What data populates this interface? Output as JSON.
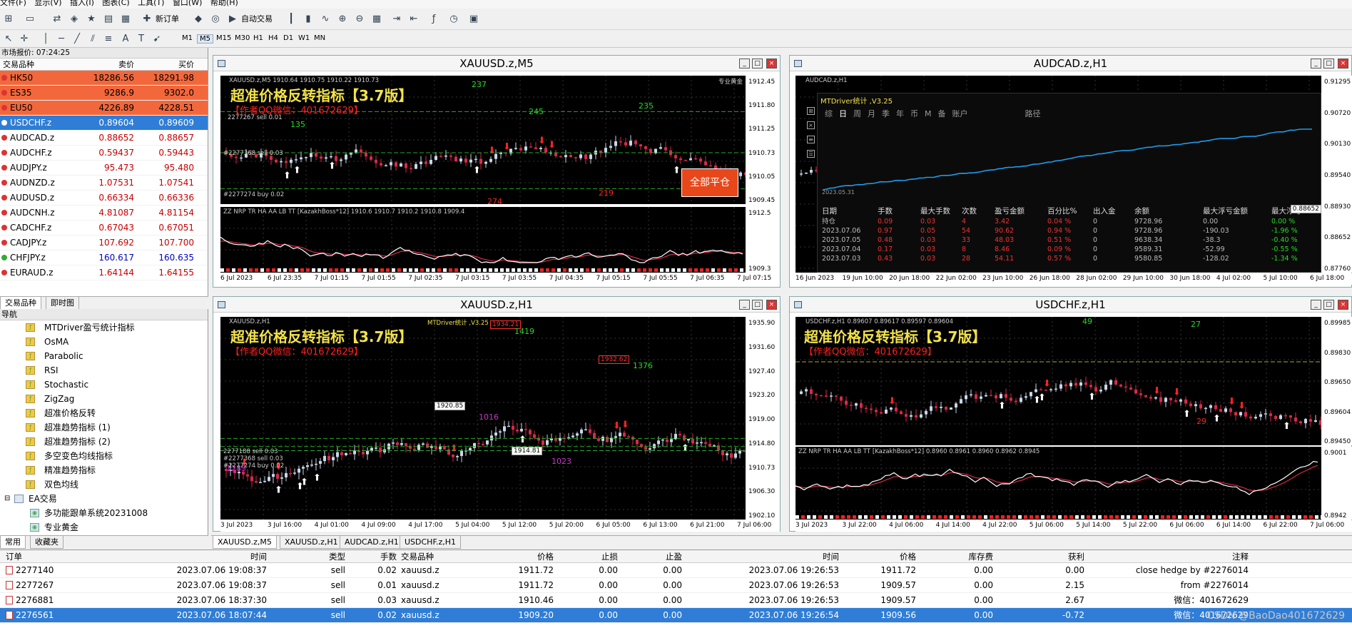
{
  "menubar": [
    "文件(F)",
    "显示(V)",
    "插入(I)",
    "图表(C)",
    "工具(T)",
    "窗口(W)",
    "帮助(H)"
  ],
  "toolbar": {
    "new_order": "新订单",
    "autotrade": "自动交易"
  },
  "timeframes": [
    "M1",
    "M5",
    "M15",
    "M30",
    "H1",
    "H4",
    "D1",
    "W1",
    "MN"
  ],
  "market_watch": {
    "title": "市场报价: 07:24:25",
    "headers": [
      "交易品种",
      "卖价",
      "买价"
    ],
    "rows": [
      {
        "symbol": "HK50",
        "bid": "18286.56",
        "ask": "18291.98",
        "style": "red"
      },
      {
        "symbol": "ES35",
        "bid": "9286.9",
        "ask": "9302.0",
        "style": "red"
      },
      {
        "symbol": "EU50",
        "bid": "4226.89",
        "ask": "4228.51",
        "style": "red"
      },
      {
        "symbol": "USDCHF.z",
        "bid": "0.89604",
        "ask": "0.89609",
        "style": "sel"
      },
      {
        "symbol": "AUDCAD.z",
        "bid": "0.88652",
        "ask": "0.88657",
        "style": "dn"
      },
      {
        "symbol": "AUDCHF.z",
        "bid": "0.59437",
        "ask": "0.59443",
        "style": "dn"
      },
      {
        "symbol": "AUDJPY.z",
        "bid": "95.473",
        "ask": "95.480",
        "style": "dn"
      },
      {
        "symbol": "AUDNZD.z",
        "bid": "1.07531",
        "ask": "1.07541",
        "style": "dn"
      },
      {
        "symbol": "AUDUSD.z",
        "bid": "0.66334",
        "ask": "0.66336",
        "style": "dn"
      },
      {
        "symbol": "AUDCNH.z",
        "bid": "4.81087",
        "ask": "4.81154",
        "style": "dn"
      },
      {
        "symbol": "CADCHF.z",
        "bid": "0.67043",
        "ask": "0.67051",
        "style": "dn"
      },
      {
        "symbol": "CADJPY.z",
        "bid": "107.692",
        "ask": "107.700",
        "style": "dn"
      },
      {
        "symbol": "CHFJPY.z",
        "bid": "160.617",
        "ask": "160.635",
        "style": "up"
      },
      {
        "symbol": "EURAUD.z",
        "bid": "1.64144",
        "ask": "1.64155",
        "style": "dn"
      }
    ],
    "tabs": [
      "交易品种",
      "即时图"
    ]
  },
  "navigator": {
    "title": "导航",
    "items": [
      "MTDriver盈亏统计指标",
      "OsMA",
      "Parabolic",
      "RSI",
      "Stochastic",
      "ZigZag",
      "超准价格反转",
      "超准趋势指标 (1)",
      "超准趋势指标 (2)",
      "多空变色均线指标",
      "精准趋势指标",
      "双色均线"
    ],
    "folder": "EA交易",
    "ea_items": [
      "多功能跟单系统20231008",
      "专业黄金"
    ],
    "tabs": [
      "常用",
      "收藏夹"
    ]
  },
  "charts": {
    "c1": {
      "title": "XAUUSD.z,M5",
      "header": "XAUUSD.z,M5  1910.64 1910.75 1910.22 1910.73",
      "overlay_title": "超准价格反转指标【3.7版】",
      "overlay_author": "【作者QQ微信：401672629】",
      "corner_label": "专业黄金",
      "sub_header": "ZZ NRP TR HA AA LB TT [KazakhBoss*12]  1910.6 1910.7 1910.2 1910.8 1909.4",
      "close_all": "全部平仓",
      "labels": [
        "2277267 sell 0.01",
        "#2277368 sell 0.03",
        "#2277274 buy 0.02",
        "245",
        "235",
        "135",
        "219",
        "274",
        "237"
      ],
      "price_tag": "1910.73",
      "y_ticks": [
        "1912.45",
        "1911.80",
        "1911.25",
        "1910.73",
        "1910.05",
        "1909.45"
      ],
      "sub_y_ticks": [
        "1912.5",
        "1909.3"
      ],
      "x_ticks": [
        "6 Jul 2023",
        "6 Jul 23:35",
        "7 Jul 01:15",
        "7 Jul 01:55",
        "7 Jul 02:35",
        "7 Jul 03:15",
        "7 Jul 03:55",
        "7 Jul 04:35",
        "7 Jul 05:15",
        "7 Jul 05:55",
        "7 Jul 06:35",
        "7 Jul 07:15"
      ]
    },
    "c2": {
      "title": "AUDCAD.z,H1",
      "header": "AUDCAD.z,H1",
      "stats_title": "MTDriver统计 ,V3.25",
      "stats_tabs": [
        "综",
        "日",
        "周",
        "月",
        "季",
        "年",
        "币",
        "M",
        "备",
        "账户",
        "路径"
      ],
      "equity_date": "2023.05.31",
      "table_headers": [
        "日期",
        "手数",
        "最大手数",
        "次数",
        "盈亏金额",
        "百分比%",
        "出入金",
        "余额",
        "最大浮亏金额",
        "最大浮亏%"
      ],
      "table_rows": [
        [
          "持仓",
          "0.09",
          "0.03",
          "4",
          "3.42",
          "0.04 %",
          "0",
          "9728.96",
          "0.00",
          "0.00 %"
        ],
        [
          "2023.07.06",
          "0.97",
          "0.05",
          "54",
          "90.62",
          "0.94 %",
          "0",
          "9728.96",
          "-190.03",
          "-1.96 %"
        ],
        [
          "2023.07.05",
          "0.48",
          "0.03",
          "33",
          "48.03",
          "0.51 %",
          "0",
          "9638.34",
          "-38.3",
          "-0.40 %"
        ],
        [
          "2023.07.04",
          "0.17",
          "0.03",
          "8",
          "8.46",
          "0.09 %",
          "0",
          "9589.31",
          "-52.99",
          "-0.55 %"
        ],
        [
          "2023.07.03",
          "0.43",
          "0.03",
          "28",
          "54.11",
          "0.57 %",
          "0",
          "9580.85",
          "-128.02",
          "-1.34 %"
        ]
      ],
      "price_tag": "0.88652",
      "y_ticks": [
        "0.91295",
        "0.90720",
        "0.90130",
        "0.89540",
        "0.88930",
        "0.88652",
        "0.87760"
      ],
      "x_ticks": [
        "16 Jun 2023",
        "19 Jun 10:00",
        "20 Jun 18:00",
        "22 Jun 02:00",
        "23 Jun 10:00",
        "26 Jun 18:00",
        "28 Jun 02:00",
        "29 Jun 10:00",
        "30 Jun 18:00",
        "4 Jul 02:00",
        "5 Jul 10:00",
        "6 Jul 18:00"
      ]
    },
    "c3": {
      "title": "XAUUSD.z,H1",
      "header": "XAUUSD.z,H1",
      "stats_mini": "MTDriver统计 ,V3.25",
      "overlay_title": "超准价格反转指标【3.7版】",
      "overlay_author": "【作者QQ微信：401672629】",
      "boxes": [
        "1920.85",
        "1914.81",
        "1932.62",
        "1934.21"
      ],
      "labels": [
        "1419",
        "1016",
        "1023",
        "1376",
        "2277188 sell 0.03",
        "#2277368 sell 0.03",
        "#2277274 buy 0.02",
        "1285"
      ],
      "price_tag": "1910.73",
      "y_ticks": [
        "1935.90",
        "1931.60",
        "1927.40",
        "1923.20",
        "1919.00",
        "1914.80",
        "1910.73",
        "1906.30",
        "1902.10"
      ],
      "x_ticks": [
        "3 Jul 2023",
        "3 Jul 16:00",
        "4 Jul 01:00",
        "4 Jul 09:00",
        "4 Jul 17:00",
        "5 Jul 04:00",
        "5 Jul 12:00",
        "5 Jul 20:00",
        "6 Jul 05:00",
        "6 Jul 13:00",
        "6 Jul 21:00",
        "7 Jul 06:00"
      ]
    },
    "c4": {
      "title": "USDCHF.z,H1",
      "header": "USDCHF.z,H1  0.89607 0.89617 0.89597 0.89604",
      "overlay_title": "超准价格反转指标【3.7版】",
      "overlay_author": "【作者QQ微信：401672629】",
      "sub_header": "ZZ NRP TR HA AA LB TT [KazakhBoss*12]  0.8960 0.8961 0.8960 0.8962 0.8945",
      "labels": [
        "49",
        "27",
        "29"
      ],
      "price_tag": "0.89604",
      "y_ticks": [
        "0.89985",
        "0.89830",
        "0.89650",
        "0.89604",
        "0.89450"
      ],
      "sub_y_ticks": [
        "0.9001",
        "0.8942"
      ],
      "x_ticks": [
        "3 Jul 2023",
        "3 Jul 22:00",
        "4 Jul 06:00",
        "4 Jul 14:00",
        "4 Jul 22:00",
        "5 Jul 06:00",
        "5 Jul 14:00",
        "5 Jul 22:00",
        "6 Jul 06:00",
        "6 Jul 14:00",
        "6 Jul 22:00",
        "7 Jul 06:00"
      ]
    }
  },
  "chart_tabs": [
    "XAUUSD.z,M5",
    "XAUUSD.z,H1",
    "AUDCAD.z,H1",
    "USDCHF.z,H1"
  ],
  "terminal": {
    "headers": [
      "订单",
      "时间",
      "类型",
      "手数",
      "交易品种",
      "价格",
      "止损",
      "止盈",
      "时间",
      "价格",
      "库存费",
      "获利",
      "注释"
    ],
    "rows": [
      [
        "2277140",
        "2023.07.06 19:08:37",
        "sell",
        "0.02",
        "xauusd.z",
        "1911.72",
        "0.00",
        "0.00",
        "2023.07.06 19:26:53",
        "1911.72",
        "0.00",
        "0.00",
        "close hedge by #2276014"
      ],
      [
        "2277267",
        "2023.07.06 19:08:37",
        "sell",
        "0.01",
        "xauusd.z",
        "1911.72",
        "0.00",
        "0.00",
        "2023.07.06 19:26:53",
        "1909.57",
        "0.00",
        "2.15",
        "from #2276014"
      ],
      [
        "2276881",
        "2023.07.06 18:37:30",
        "sell",
        "0.03",
        "xauusd.z",
        "1910.46",
        "0.00",
        "0.00",
        "2023.07.06 19:26:53",
        "1909.57",
        "0.00",
        "2.67",
        "微信：401672629"
      ],
      [
        "2276561",
        "2023.07.06 18:07:44",
        "sell",
        "0.02",
        "xauusd.z",
        "1909.20",
        "0.00",
        "0.00",
        "2023.07.06 19:26:54",
        "1909.56",
        "0.00",
        "-0.72",
        "微信：401672629"
      ]
    ]
  },
  "watermark": "CSDN @BaoDao401672629"
}
